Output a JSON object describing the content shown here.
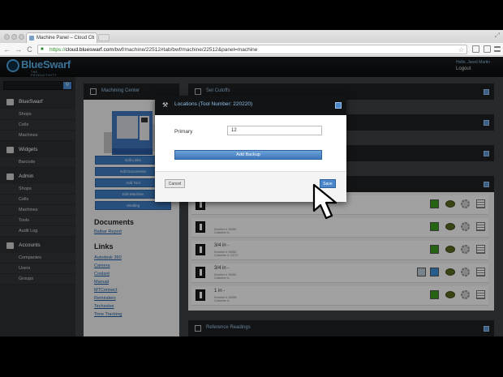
{
  "browser": {
    "tab_title": "Machine Panel – Cloud Co",
    "tab_close": "×",
    "url_scheme": "https://",
    "url_host": "cloud.blueswarf.com",
    "url_path": "/bwf/machine/22512#tab/bwf/machine/22512&panel=machine",
    "back": "←",
    "forward": "→",
    "reload": "C",
    "star": "☆",
    "expand": "⤢"
  },
  "header": {
    "logo_text": "BlueSwarf",
    "logo_sub": "THE PRODUCTIVITY HUB",
    "hello": "Hello, Jared Martin",
    "logout": "Logout"
  },
  "sidebar": {
    "search_icon": "⚲",
    "sections": [
      {
        "label": "BlueSwarf",
        "items": [
          "Shops",
          "Cells",
          "Machines"
        ]
      },
      {
        "label": "Widgets",
        "items": [
          "Barcode"
        ]
      },
      {
        "label": "Admin",
        "items": [
          "Shops",
          "Cells",
          "Machines",
          "Tools",
          "Audit Log"
        ]
      },
      {
        "label": "Accounts",
        "items": [
          "Companies",
          "Users",
          "Groups"
        ]
      }
    ]
  },
  "left_panel": {
    "title": "Machining Center",
    "buttons": [
      "Edit Links",
      "Edit Documents",
      "Add Tool",
      "Edit Machine",
      "Vending"
    ],
    "documents_title": "Documents",
    "documents": [
      "Balbar Report"
    ],
    "links_title": "Links",
    "links": [
      "Autodesk 360",
      "Camera",
      "Coolant",
      "Manual",
      "MTConnect",
      "Reminders",
      "Techsolve",
      "Time Tracking"
    ]
  },
  "right_panels": [
    {
      "title": "Set Cutoffs"
    },
    {
      "title": ""
    },
    {
      "title": ""
    },
    {
      "title": ""
    }
  ],
  "tools": [
    {
      "name": "",
      "sub1": "",
      "sub2": "",
      "status": "green"
    },
    {
      "name": "",
      "sub1": "Knubbel #: 90280",
      "sub2": "Customer #:",
      "status": "green"
    },
    {
      "name": "3/4 in -",
      "sub1": "Knubbel #: 90260",
      "sub2": "Customer #: 13717",
      "status": "green"
    },
    {
      "name": "3/4 in -",
      "sub1": "Knubbel #: 90281",
      "sub2": "Customer #:",
      "status": "blue"
    },
    {
      "name": "1 in -",
      "sub1": "Knubbel #: 90286",
      "sub2": "Customer #:",
      "status": "green"
    }
  ],
  "bottom_panel": {
    "title": "Reference Readings"
  },
  "modal": {
    "title": "Locations (Tool Number: 220220)",
    "primary_label": "Primary",
    "primary_value": "12",
    "add_backup": "Add Backup",
    "cancel": "Cancel",
    "save": "Save"
  },
  "colors": {
    "accent": "#4a86c8",
    "status_green": "#3a9a1a",
    "status_blue": "#3b8fd8"
  }
}
